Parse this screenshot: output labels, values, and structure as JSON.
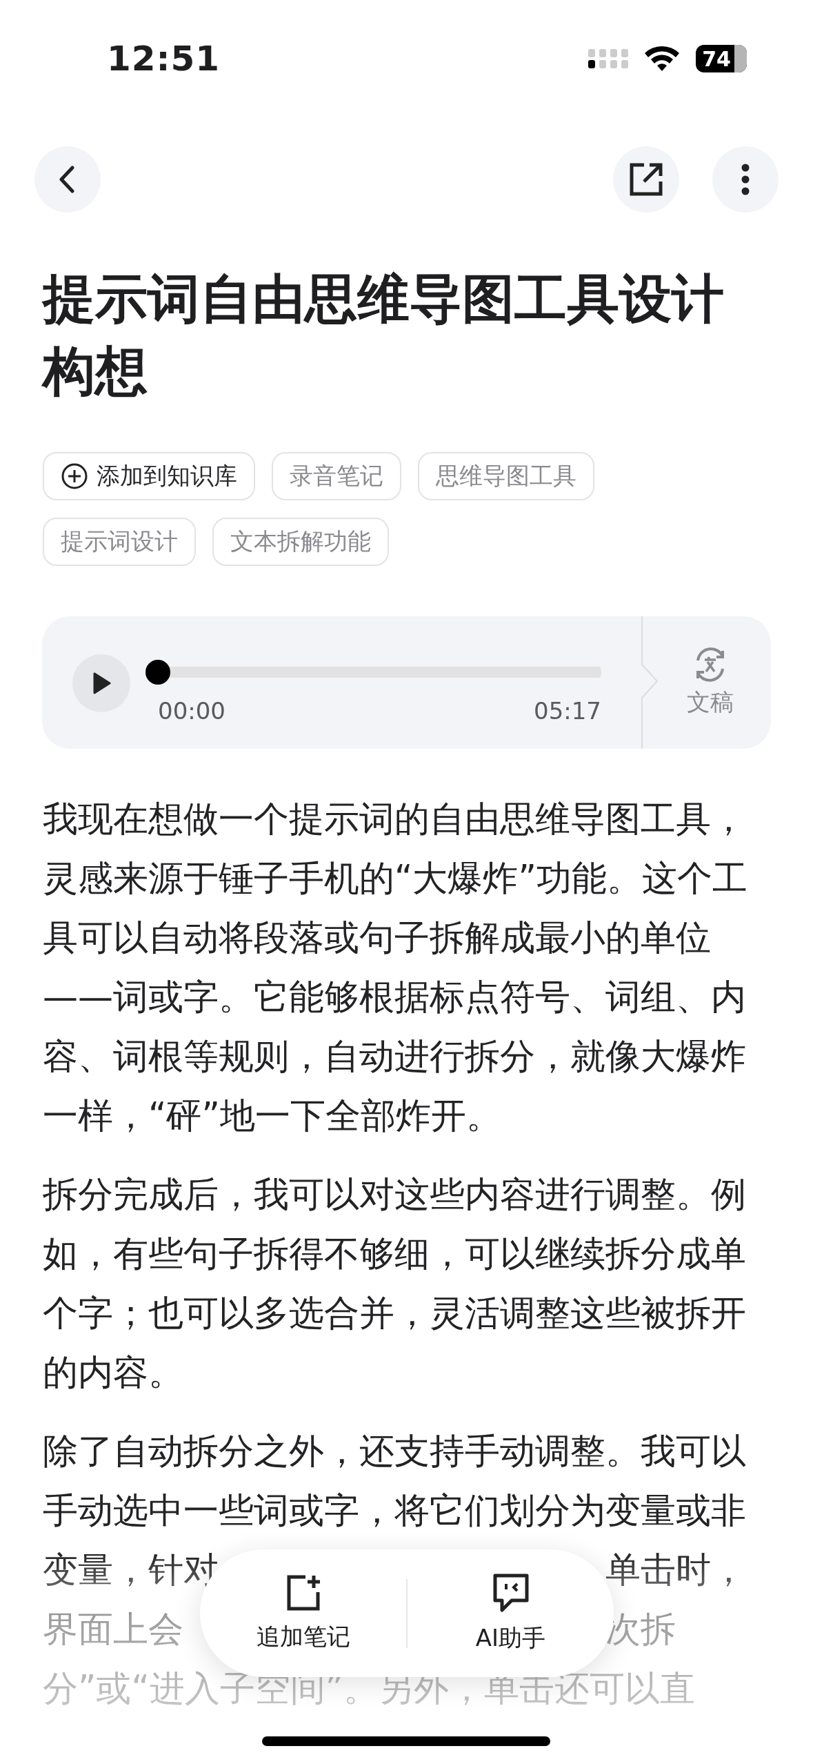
{
  "status_bar": {
    "time": "12:51",
    "battery": "74"
  },
  "title": "提示词自由思维导图工具设计构想",
  "tags": [
    {
      "kind": "action",
      "label": "添加到知识库"
    },
    {
      "kind": "tag",
      "label": "录音笔记"
    },
    {
      "kind": "tag",
      "label": "思维导图工具"
    },
    {
      "kind": "tag",
      "label": "提示词设计"
    },
    {
      "kind": "tag",
      "label": "文本拆解功能"
    }
  ],
  "audio": {
    "level": 0,
    "elapsed": "00:00",
    "duration": "05:17",
    "transcript_label": "文稿"
  },
  "paragraphs": [
    "我现在想做一个提示词的自由思维导图工具，灵感来源于锤子手机的“大爆炸”功能。这个工具可以自动将段落或句子拆解成最小的单位——词或字。它能够根据标点符号、词组、内容、词根等规则，自动进行拆分，就像大爆炸一样，“砰”地一下全部炸开。",
    "拆分完成后，我可以对这些内容进行调整。例如，有些句子拆得不够细，可以继续拆分成单个字；也可以多选合并，灵活调整这些被拆开的内容。"
  ],
  "partial_paragraph": [
    [
      "除了自动拆分之外，还支持手动调整。我可以"
    ],
    [
      "手动选中一些词或字，将它们划分为变量或非"
    ],
    [
      "变量，针对",
      "单击时，"
    ],
    [
      "界面上会",
      "次拆"
    ],
    [
      "分”或“进入子空间”。另外，单击还可以直"
    ]
  ],
  "bottom_bar": {
    "items": [
      {
        "kind": "add_note",
        "label": "追加笔记"
      },
      {
        "kind": "assistant",
        "label": "AI助手"
      }
    ]
  }
}
